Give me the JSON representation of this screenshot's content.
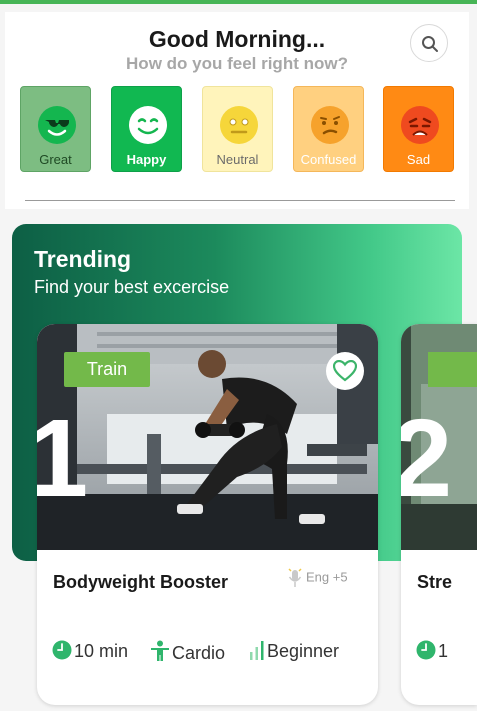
{
  "header": {
    "greeting": "Good Morning...",
    "subtitle": "How do you feel right now?"
  },
  "search": {
    "icon": "search-icon"
  },
  "moods": [
    {
      "label": "Great",
      "face": "cool-face-icon",
      "bg": "#7dbd82",
      "border": "#5ea465",
      "label_color": "#1f4a24"
    },
    {
      "label": "Happy",
      "face": "smile-face-icon",
      "bg": "#11b851",
      "border": "#0ea049",
      "label_color": "#ffffff"
    },
    {
      "label": "Neutral",
      "face": "neutral-face-icon",
      "bg": "#fff4bb",
      "border": "#f0e49c",
      "label_color": "#6b6b6b"
    },
    {
      "label": "Confused",
      "face": "confused-face-icon",
      "bg": "#ffd080",
      "border": "#f4b75a",
      "label_color": "#ffffff"
    },
    {
      "label": "Sad",
      "face": "sad-face-icon",
      "bg": "#ff8a14",
      "border": "#f27a00",
      "label_color": "#ffffff"
    }
  ],
  "trending": {
    "title": "Trending",
    "subtitle": "Find your best excercise"
  },
  "cards": [
    {
      "rank": "1",
      "tag": "Train",
      "title": "Bodyweight Booster",
      "language": "Eng +5",
      "duration": "10 min",
      "category": "Cardio",
      "level": "Beginner"
    },
    {
      "rank": "2",
      "title": "Stre",
      "duration": "1"
    }
  ],
  "colors": {
    "accent": "#47b556",
    "tag": "#73b94a",
    "icon_green": "#2fb56c"
  }
}
